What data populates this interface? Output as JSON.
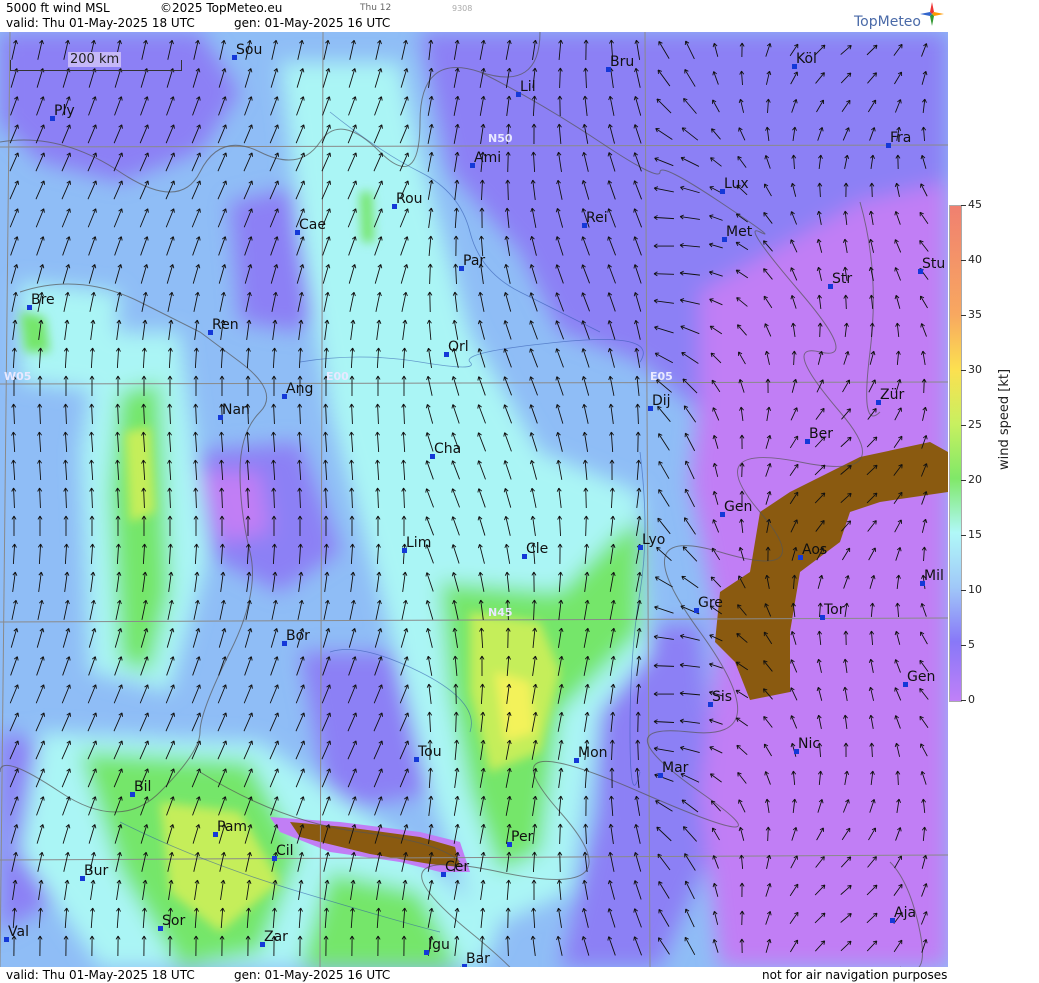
{
  "header": {
    "product": "5000 ft wind MSL",
    "copyright": "©2025 TopMeteo.eu",
    "run_tag": "Thu 12",
    "code": "9308",
    "valid": "valid:  Thu  01-May-2025  18 UTC",
    "gen": "gen: 01-May-2025 16 UTC",
    "logo": "TopMeteo"
  },
  "footer": {
    "valid": "valid:  Thu  01-May-2025  18 UTC",
    "gen": "gen: 01-May-2025 16 UTC",
    "disclaimer": "not for air navigation purposes"
  },
  "scale_bar": "200 km",
  "grid_labels": [
    "N50",
    "N45",
    "W05",
    "E00",
    "E05"
  ],
  "legend": {
    "title": "wind speed  [kt]",
    "ticks": [
      "45",
      "40",
      "35",
      "30",
      "25",
      "20",
      "15",
      "10",
      "5",
      "0"
    ],
    "colors": [
      "#f08070",
      "#f8a860",
      "#fce050",
      "#c8f060",
      "#80e868",
      "#b0f8f8",
      "#a0c8f8",
      "#8878f8",
      "#c878f0",
      "#c080f8"
    ]
  },
  "colors": {
    "calm": "#c17ef5",
    "light": "#8c80f5",
    "moderate": "#8fbdf6",
    "fresh": "#aaf5f5",
    "strong": "#75e66a",
    "high": "#c5ee5a",
    "peak": "#f3f25a",
    "terrain": "#8a5a10",
    "city_marker": "#1438d8"
  },
  "cities": [
    "Sou",
    "Ply",
    "Lil",
    "Bru",
    "Köl",
    "Ami",
    "Fra",
    "Rou",
    "Lux",
    "Cae",
    "Rei",
    "Met",
    "Par",
    "Stu",
    "Bre",
    "Str",
    "Ren",
    "Orl",
    "Ang",
    "Nan",
    "Dij",
    "Zür",
    "Cha",
    "Ber",
    "Gen",
    "Lim",
    "Cle",
    "Lyo",
    "Aos",
    "Mil",
    "Gre",
    "Tor",
    "Bor",
    "Sis",
    "Gen",
    "Tou",
    "Mon",
    "Nic",
    "Mar",
    "Bil",
    "Pam",
    "Cil",
    "Per",
    "Cer",
    "Bur",
    "Sor",
    "Aja",
    "Val",
    "Zar",
    "Igu",
    "Bar"
  ]
}
